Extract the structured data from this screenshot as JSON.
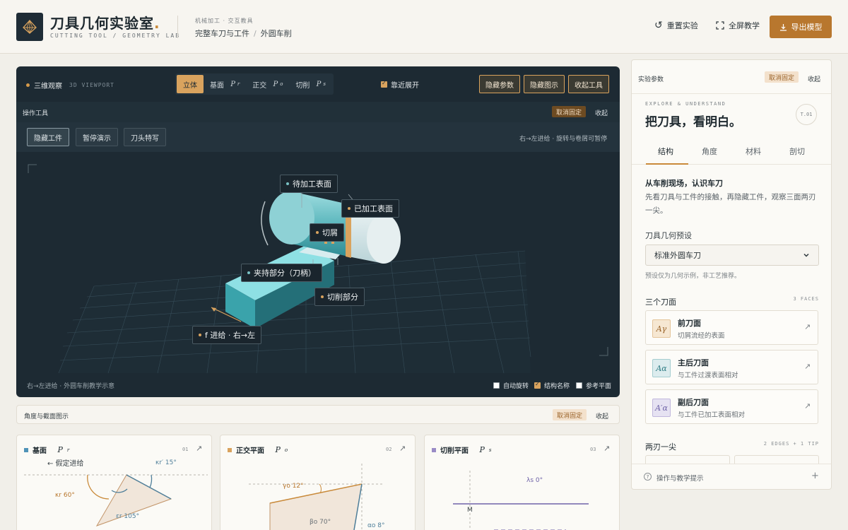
{
  "header": {
    "title": "刀具几何实验室",
    "title_dot": ".",
    "subtitle": "CUTTING TOOL / GEOMETRY LAB",
    "crumb_top": "机械加工 · 交互教具",
    "crumb_1": "完整车刀与工件",
    "crumb_sep": "/",
    "crumb_2": "外圆车削",
    "reset_label": "重置实验",
    "fullscreen_label": "全屏教学",
    "export_label": "导出模型"
  },
  "viewport": {
    "title": "三维观察",
    "title_en": "3D VIEWPORT",
    "tabs": [
      {
        "label": "立体",
        "sym": "",
        "sub": ""
      },
      {
        "label": "基面",
        "sym": "P",
        "sub": "r"
      },
      {
        "label": "正交",
        "sym": "P",
        "sub": "o"
      },
      {
        "label": "切削",
        "sym": "P",
        "sub": "s"
      }
    ],
    "near_expand": "靠近展开",
    "hide_params": "隐藏参数",
    "hide_diagram": "隐藏图示",
    "collapse_tools": "收起工具",
    "tools_label": "操作工具",
    "unpin": "取消固定",
    "fold": "收起",
    "hide_workpiece": "隐藏工件",
    "pause_demo": "暂停演示",
    "tool_closeup": "刀头特写",
    "hint": "右→左进给 · 旋转与卷屑可暂停",
    "callouts": {
      "unmachined": "待加工表面",
      "machined": "已加工表面",
      "chip": "切屑",
      "shank": "夹持部分（刀柄）",
      "cutting_part": "切削部分",
      "feed": "f 进给 · 右→左"
    },
    "footer_note": "右→左进给 · 外圆车削教学示意",
    "auto_rotate": "自动旋转",
    "struct_names": "结构名称",
    "ref_planes": "参考平面"
  },
  "angles": {
    "label": "角度与截面图示",
    "unpin": "取消固定",
    "fold": "收起",
    "cards": [
      {
        "title": "基面",
        "sym": "P",
        "sub": "r",
        "num": "01",
        "color": "#4f93b8"
      },
      {
        "title": "正交平面",
        "sym": "P",
        "sub": "o",
        "num": "02",
        "color": "#d9a35e"
      },
      {
        "title": "切削平面",
        "sym": "P",
        "sub": "s",
        "num": "03",
        "color": "#9a8cc6"
      }
    ],
    "card1": {
      "feed": "← 假定进给",
      "kr_minor": "κr′ 15°",
      "kr": "κr 60°",
      "er": "εr 105°"
    },
    "card2": {
      "gamma": "γo 12°",
      "beta": "βo 70°",
      "alpha": "αo 8°"
    },
    "card3": {
      "lambda": "λs 0°",
      "m": "M"
    }
  },
  "panel": {
    "label": "实验参数",
    "unpin": "取消固定",
    "fold": "收起",
    "en": "EXPLORE & UNDERSTAND",
    "title": "把刀具，看明白。",
    "badge": "T.01",
    "tabs": [
      "结构",
      "角度",
      "材料",
      "剖切"
    ],
    "sec_title": "从车削现场，认识车刀",
    "sec_text": "先看刀具与工件的接触，再隐藏工件，观察三面两刃一尖。",
    "preset_label": "刀具几何预设",
    "preset_value": "标准外圆车刀",
    "preset_note": "预设仅为几何示例，非工艺推荐。",
    "faces_title": "三个刀面",
    "faces_count": "3 FACES",
    "faces": [
      {
        "icon": "Aγ",
        "name": "前刀面",
        "desc": "切屑流经的表面"
      },
      {
        "icon": "Aα",
        "name": "主后刀面",
        "desc": "与工件过渡表面相对"
      },
      {
        "icon": "A′α",
        "name": "副后刀面",
        "desc": "与工件已加工表面相对"
      }
    ],
    "edges_title": "两刃一尖",
    "edges_count": "2 EDGES + 1 TIP",
    "footer": "操作与教学提示",
    "colors": {
      "accent": "#c98a3a",
      "dark": "#1d2a33"
    }
  }
}
